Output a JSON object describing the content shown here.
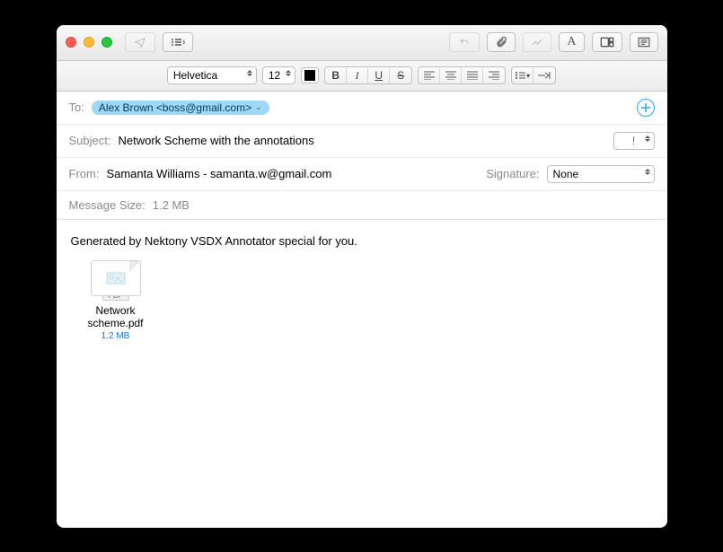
{
  "format": {
    "font": "Helvetica",
    "size": "12"
  },
  "fields": {
    "to_label": "To:",
    "to_chip": "Alex Brown <boss@gmail.com>",
    "subject_label": "Subject:",
    "subject_value": "Network Scheme with the annotations",
    "from_label": "From:",
    "from_value": "Samanta Williams - samanta.w@gmail.com",
    "signature_label": "Signature:",
    "signature_value": "None",
    "size_label": "Message Size:",
    "size_value": "1.2 MB",
    "priority_mark": "!"
  },
  "body": {
    "text": "Generated by Nektony VSDX Annotator special for you.",
    "attachment": {
      "badge": "PDF",
      "name": "Network scheme.pdf",
      "size": "1.2 MB"
    }
  }
}
